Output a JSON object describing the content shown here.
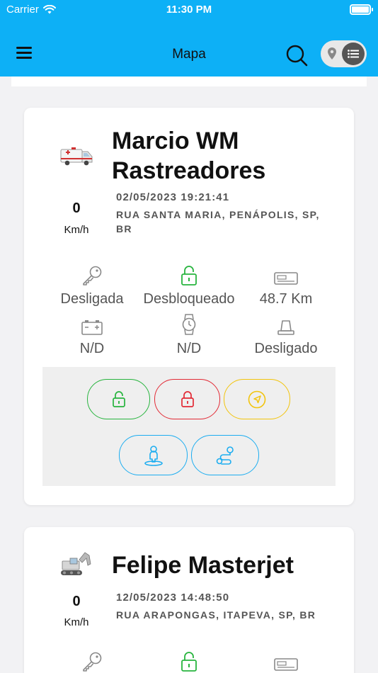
{
  "status_bar": {
    "carrier": "Carrier",
    "time": "11:30 PM"
  },
  "header": {
    "title": "Mapa"
  },
  "colors": {
    "header_bg": "#0db0f6",
    "unlock_green": "#27b43e",
    "lock_red": "#e22a35",
    "locate_yellow": "#f2c40c",
    "share_blue": "#1cadf0"
  },
  "vehicles": [
    {
      "name": "Marcio WM Rastreadores",
      "icon": "ambulance-icon",
      "speed": "0",
      "speed_unit": "Km/h",
      "datetime": "02/05/2023 19:21:41",
      "address": "RUA SANTA MARIA, PENÁPOLIS, SP, BR",
      "stats": [
        {
          "icon": "key-icon",
          "label": "Desligada"
        },
        {
          "icon": "unlock-icon",
          "label": "Desbloqueado"
        },
        {
          "icon": "odometer-icon",
          "label": "48.7 Km"
        },
        {
          "icon": "battery-icon",
          "label": "N/D"
        },
        {
          "icon": "watch-icon",
          "label": "N/D"
        },
        {
          "icon": "siren-icon",
          "label": "Desligado"
        }
      ]
    },
    {
      "name": "Felipe Masterjet",
      "icon": "excavator-icon",
      "speed": "0",
      "speed_unit": "Km/h",
      "datetime": "12/05/2023 14:48:50",
      "address": "RUA ARAPONGAS, ITAPEVA, SP, BR",
      "stats": [
        {
          "icon": "key-icon",
          "label": ""
        },
        {
          "icon": "unlock-icon",
          "label": ""
        },
        {
          "icon": "odometer-icon",
          "label": ""
        }
      ]
    }
  ]
}
